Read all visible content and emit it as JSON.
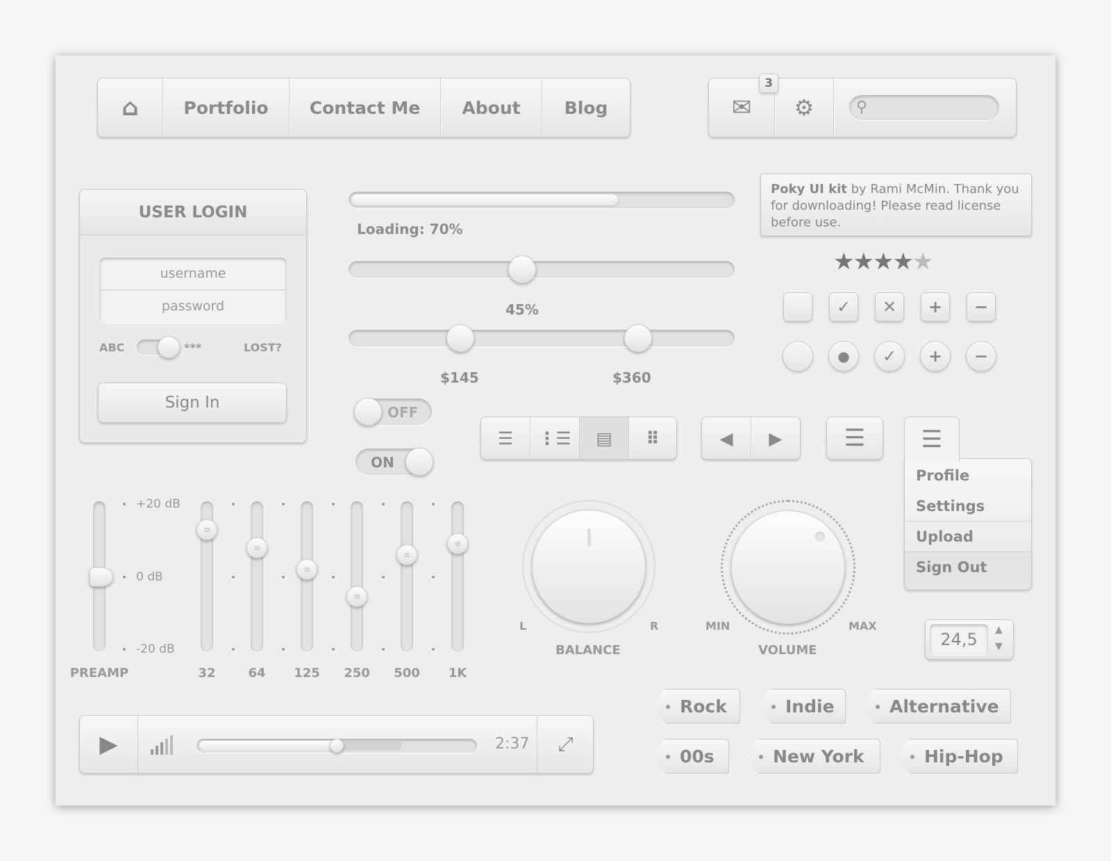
{
  "nav": {
    "items": [
      "Portfolio",
      "Contact Me",
      "About",
      "Blog"
    ]
  },
  "toolbar": {
    "mail_badge": "3",
    "search_placeholder": ""
  },
  "login": {
    "title": "USER LOGIN",
    "username_placeholder": "username",
    "password_placeholder": "password",
    "toggle_left": "ABC",
    "toggle_right": "***",
    "lost": "LOST?",
    "sign_in": "Sign In"
  },
  "progress": {
    "value": 70,
    "label": "Loading: 70%"
  },
  "slider": {
    "value": 45,
    "label": "45%"
  },
  "range": {
    "low_label": "$145",
    "high_label": "$360",
    "low": 0.29,
    "high": 0.75
  },
  "toggles": {
    "off": "OFF",
    "on": "ON"
  },
  "tooltip": {
    "bold": "Poky UI kit",
    "text": " by Rami McMin. Thank you for downloading! Please read license before use."
  },
  "rating": {
    "value": 4,
    "max": 5
  },
  "checkboxes": [
    "empty",
    "check",
    "x",
    "plus",
    "minus"
  ],
  "radios": [
    "empty",
    "dot",
    "check",
    "plus",
    "minus"
  ],
  "view_buttons": [
    "list-icon",
    "bullet-list-icon",
    "detail-list-icon",
    "grid-icon"
  ],
  "dropdown": {
    "items": [
      "Profile",
      "Settings",
      "Upload",
      "Sign Out"
    ]
  },
  "knobs": {
    "balance": {
      "label": "BALANCE",
      "left": "L",
      "right": "R",
      "value": 0
    },
    "volume": {
      "label": "VOLUME",
      "min": "MIN",
      "max": "MAX",
      "value": 0.55
    }
  },
  "stepper": {
    "value": "24,5"
  },
  "eq": {
    "scale": [
      "+20 dB",
      "0 dB",
      "-20 dB"
    ],
    "bands": [
      {
        "label": "PREAMP",
        "value": 0
      },
      {
        "label": "32",
        "value": 13
      },
      {
        "label": "64",
        "value": 8
      },
      {
        "label": "125",
        "value": 2
      },
      {
        "label": "250",
        "value": -5.5
      },
      {
        "label": "500",
        "value": 6
      },
      {
        "label": "1K",
        "value": 9
      }
    ]
  },
  "player": {
    "time": "2:37",
    "position": 0.5,
    "buffered": 0.73
  },
  "tags": [
    "Rock",
    "Indie",
    "Alternative",
    "00s",
    "New York",
    "Hip-Hop"
  ],
  "colors": {
    "background": "#eeeeee",
    "text": "#888888",
    "star_on": "#777777",
    "star_off": "#bbbbbb"
  }
}
